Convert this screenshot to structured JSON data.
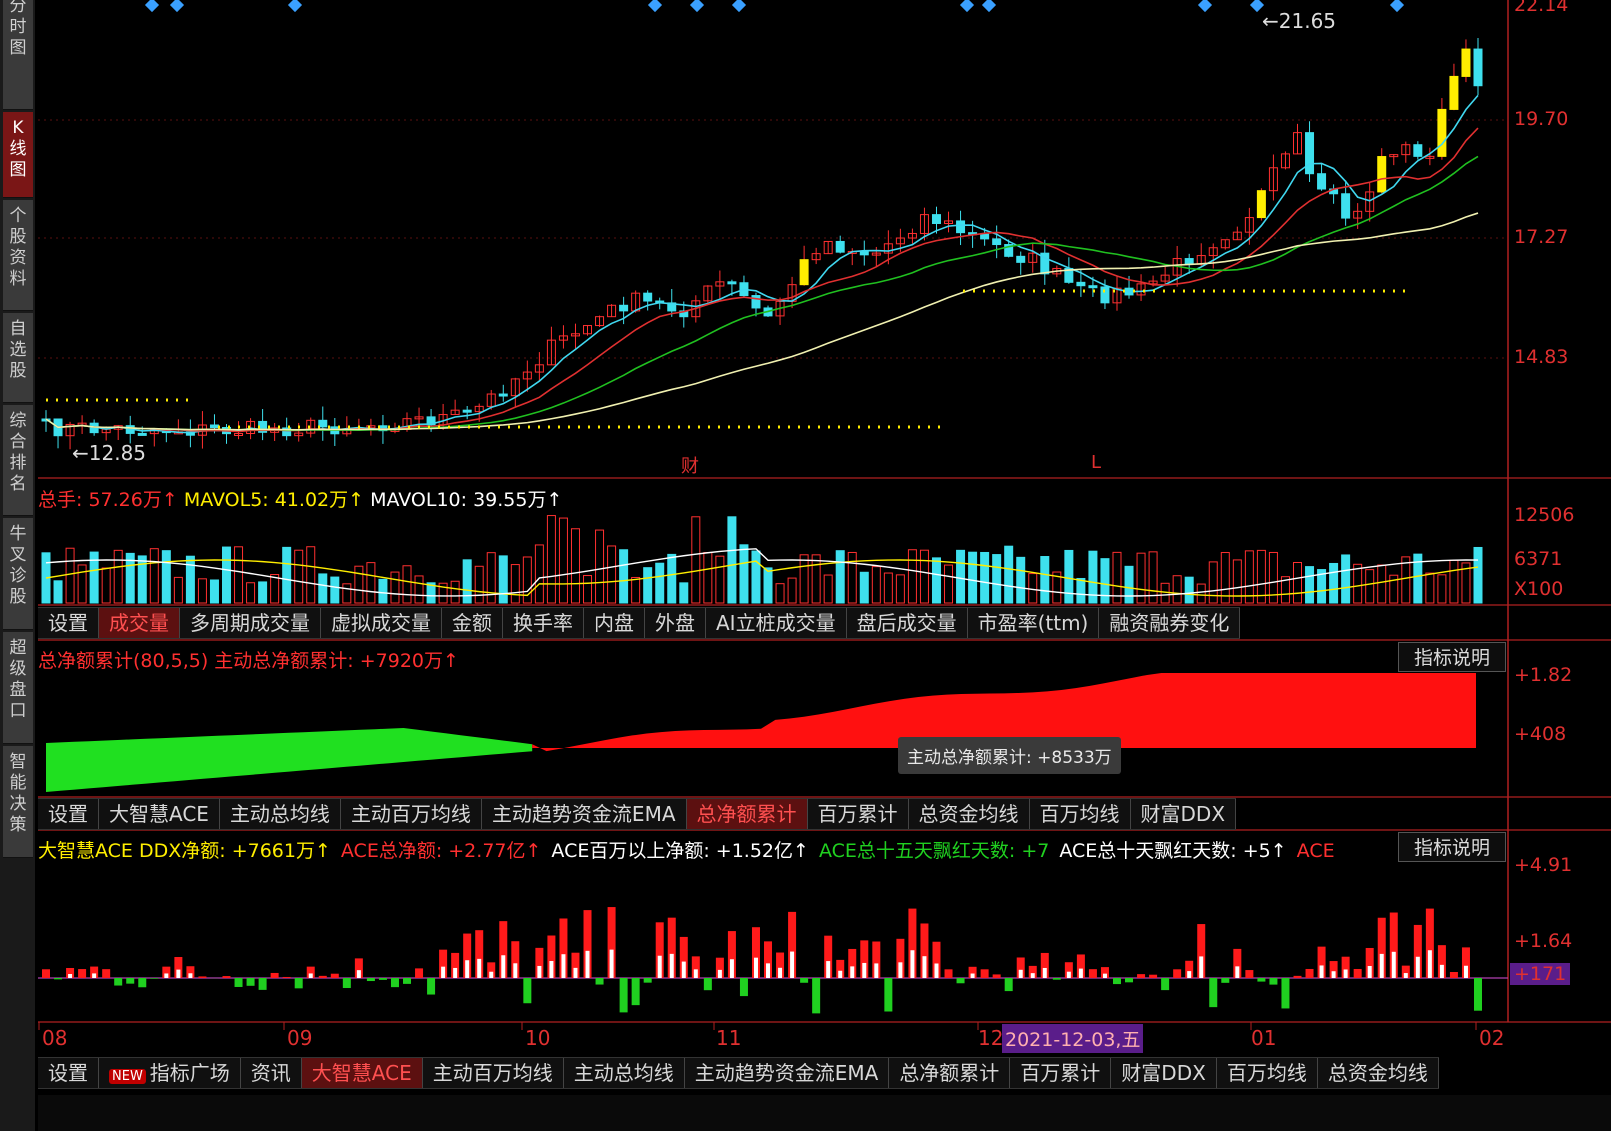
{
  "sidebar": {
    "items": [
      {
        "label": "分时图",
        "active": false
      },
      {
        "label": "K线图",
        "active": true
      },
      {
        "label": "个股资料",
        "active": false
      },
      {
        "label": "自选股",
        "active": false
      },
      {
        "label": "综合排名",
        "active": false
      },
      {
        "label": "牛叉诊股",
        "active": false
      },
      {
        "label": "超级盘口",
        "active": false
      },
      {
        "label": "智能决策",
        "active": false
      }
    ]
  },
  "price_panel": {
    "axis_labels": [
      "22.14",
      "19.70",
      "17.27",
      "14.83"
    ],
    "high_marker": "←21.65",
    "low_marker": "←12.85",
    "event_marks": [
      "财",
      "L"
    ],
    "colors": {
      "up": "#ff3030",
      "down": "#3ee0ee",
      "highlight": "#ffee00",
      "ma5": "#40d8f0",
      "ma10": "#e03030",
      "ma20": "#20c020",
      "ma60": "#f0f0b0"
    }
  },
  "volume_panel": {
    "legend": {
      "total": "总手: 57.26万↑",
      "mavol5": "MAVOL5: 41.02万↑",
      "mavol10": "MAVOL10: 39.55万↑"
    },
    "axis_labels": [
      "12506",
      "6371",
      "X100"
    ]
  },
  "tabs_row1": [
    "设置",
    "成交量",
    "多周期成交量",
    "虚拟成交量",
    "金额",
    "换手率",
    "内盘",
    "外盘",
    "AI立桩成交量",
    "盘后成交量",
    "市盈率(ttm)",
    "融资融券变化"
  ],
  "tabs_row1_active": 1,
  "net_panel": {
    "title": "总净额累计(80,5,5) 主动总净额累计: +7920万↑",
    "explain_button": "指标说明",
    "axis_labels": [
      "+1.82",
      "+408"
    ],
    "tooltip": "主动总净额累计: +8533万"
  },
  "tabs_row2": [
    "设置",
    "大智慧ACE",
    "主动总均线",
    "主动百万均线",
    "主动趋势资金流EMA",
    "总净额累计",
    "百万累计",
    "总资金均线",
    "百万均线",
    "财富DDX"
  ],
  "tabs_row2_active": 5,
  "ddx_panel": {
    "legend": [
      {
        "text": "大智慧ACE DDX净额: +7661万↑",
        "color": "#ffee00"
      },
      {
        "text": "ACE总净额: +2.77亿↑",
        "color": "#ff3030"
      },
      {
        "text": "ACE百万以上净额: +1.52亿↑",
        "color": "#ffffff"
      },
      {
        "text": "ACE总十五天飘红天数: +7",
        "color": "#20d020"
      },
      {
        "text": "ACE总十天飘红天数: +5↑",
        "color": "#ffffff"
      },
      {
        "text": "ACE",
        "color": "#ff3030"
      }
    ],
    "explain_button": "指标说明",
    "axis_labels": [
      "+4.91",
      "+1.64",
      "+171"
    ]
  },
  "time_axis": {
    "months": [
      "08",
      "09",
      "10",
      "11",
      "12",
      "01",
      "02"
    ],
    "cursor_date": "2021-12-03,五"
  },
  "tabs_row3": [
    "设置",
    "指标广场",
    "资讯",
    "大智慧ACE",
    "主动百万均线",
    "主动总均线",
    "主动趋势资金流EMA",
    "总净额累计",
    "百万累计",
    "财富DDX",
    "百万均线",
    "总资金均线"
  ],
  "tabs_row3_new_badge": "NEW",
  "tabs_row3_active": 3
}
